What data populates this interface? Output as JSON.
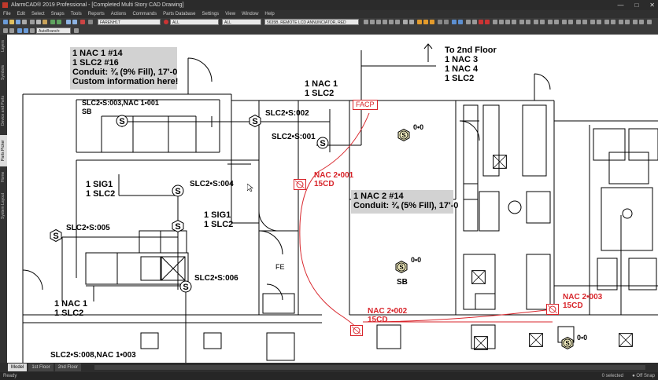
{
  "window": {
    "title": "AlarmCAD® 2019 Professional - [Completed Multi Story CAD Drawing]",
    "minimize": "—",
    "maximize": "□",
    "close": "✕"
  },
  "menu": [
    "File",
    "Edit",
    "Select",
    "Snaps",
    "Tools",
    "Reports",
    "Actions",
    "Commands",
    "Parts Database",
    "Settings",
    "View",
    "Window",
    "Help"
  ],
  "toolbar": {
    "layer_value": "FARENH1T",
    "filter_value": "ALL",
    "layer2_value": "ALL",
    "part_value": "5635B, REMOTE LCD ANNUNCIATOR, RED",
    "autobranch": "AutoBranch: NONE"
  },
  "left_tabs": [
    "Layers",
    "Symbols",
    "Device and Parts",
    "Parts Picker",
    "Home",
    "System Layout"
  ],
  "active_left_tab": "Parts Picker",
  "annotations": {
    "box1": [
      "1 NAC 1 #14",
      "1 SLC2 #16",
      "Conduit: ¾ (9% Fill), 17'-0",
      "Custom information here!"
    ],
    "box2": [
      "1 NAC 2 #14",
      "Conduit: ¾ (5% Fill), 17'-0"
    ],
    "to2nd": [
      "To 2nd Floor",
      "1 NAC 3",
      "1 NAC 4",
      "1 SLC2"
    ],
    "l_nac1_slc2_top": [
      "1 NAC 1",
      "1 SLC2"
    ],
    "l_slc2_003": [
      "SLC2•S:003,NAC 1•001",
      "SB"
    ],
    "l_slc2_002": "SLC2•S:002",
    "l_slc2_001": "SLC2•S:001",
    "l_sig1_slc2_a": [
      "1 SIG1",
      "1 SLC2"
    ],
    "l_slc2_004": "SLC2•S:004",
    "l_sig1_slc2_b": [
      "1 SIG1",
      "1 SLC2"
    ],
    "l_slc2_005": "SLC2•S:005",
    "l_slc2_006": "SLC2•S:006",
    "l_nac1_slc2_bottom": [
      "1 NAC 1",
      "1 SLC2"
    ],
    "l_slc2_008": "SLC2•S:008,NAC 1•003",
    "l_fe": "FE",
    "l_00_a": "0•0",
    "l_00_b": "0•0",
    "l_sb_b": "SB",
    "l_00_c": "0•0",
    "facp": "FACP",
    "nac2_001": [
      "NAC 2•001",
      "15CD"
    ],
    "nac2_002": [
      "NAC 2•002",
      "15CD"
    ],
    "nac2_003": [
      "NAC 2•003",
      "15CD"
    ]
  },
  "layout_tabs": [
    "Model",
    "1st Floor",
    "2nd Floor"
  ],
  "status": {
    "ready": "Ready",
    "selected": "0 selected",
    "snap": "● Off Snap"
  },
  "colors": {
    "accent_red": "#d8252b",
    "ui_dark": "#2b2b2b"
  }
}
